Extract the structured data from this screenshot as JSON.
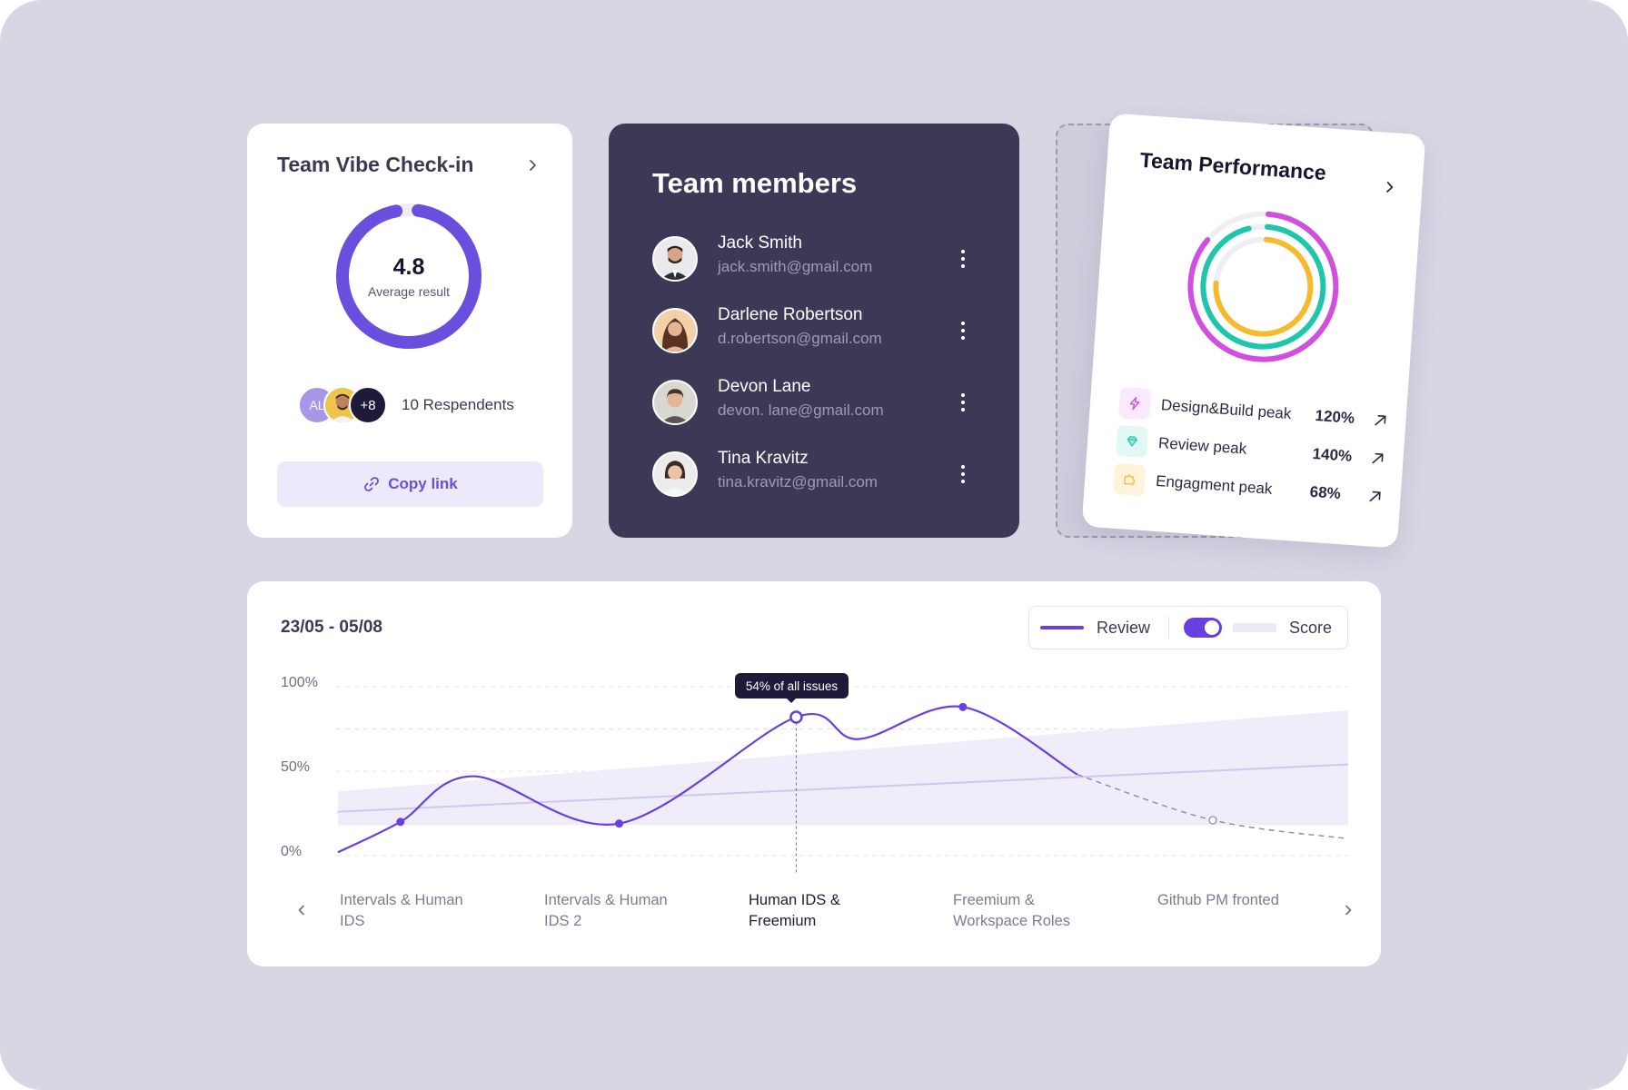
{
  "vibe": {
    "title": "Team Vibe Check-in",
    "average_value": "4.8",
    "average_label": "Average result",
    "score": 4.8,
    "score_max": 5,
    "avatar_initials": "AL",
    "avatar_more": "+8",
    "respondents": "10 Respendents",
    "copy_link": "Copy link",
    "accent": "#6a4fde"
  },
  "members": {
    "title": "Team members",
    "items": [
      {
        "name": "Jack Smith",
        "email": "jack.smith@gmail.com"
      },
      {
        "name": "Darlene Robertson",
        "email": "d.robertson@gmail.com"
      },
      {
        "name": "Devon Lane",
        "email": "devon. lane@gmail.com"
      },
      {
        "name": "Tina Kravitz",
        "email": "tina.kravitz@gmail.com"
      }
    ]
  },
  "performance": {
    "title": "Team Performance",
    "peaks": [
      {
        "label": "Design&Build peak",
        "value": "120%",
        "color": "#d04ee0",
        "icon": "lightning-icon"
      },
      {
        "label": "Review peak",
        "value": "140%",
        "color": "#1ec7ac",
        "icon": "diamond-icon"
      },
      {
        "label": "Engagment peak",
        "value": "68%",
        "color": "#f5bb2c",
        "icon": "puzzle-icon"
      }
    ]
  },
  "chart": {
    "date_range": "23/05 - 05/08",
    "legend_review": "Review",
    "legend_score": "Score",
    "tooltip": "54% of all issues"
  },
  "chart_data": {
    "type": "line",
    "categories": [
      "Intervals & Human IDS",
      "Intervals & Human IDS 2",
      "Human IDS & Freemium",
      "Freemium & Workspace Roles",
      "Github PM fronted"
    ],
    "y_ticks": [
      "100%",
      "50%",
      "0%"
    ],
    "ylim": [
      0,
      100
    ],
    "series": [
      {
        "name": "Review",
        "color": "#6a3fe0",
        "points": [
          [
            0,
            2
          ],
          [
            0.3,
            20
          ],
          [
            0.65,
            47
          ],
          [
            1.35,
            19
          ],
          [
            2.2,
            82
          ],
          [
            2.5,
            69
          ],
          [
            3.0,
            88
          ],
          [
            3.55,
            48
          ]
        ],
        "forecast": [
          [
            3.55,
            48
          ],
          [
            4.2,
            21
          ],
          [
            4.85,
            10
          ]
        ]
      },
      {
        "name": "Score",
        "color": "#cfc7f0",
        "points": [
          [
            0,
            26
          ],
          [
            4.85,
            54
          ]
        ],
        "band_low": [
          [
            0,
            18
          ],
          [
            4.85,
            18
          ]
        ],
        "band_high": [
          [
            0,
            38
          ],
          [
            4.85,
            86
          ]
        ]
      }
    ],
    "highlight": {
      "category": "Human IDS & Freemium",
      "x": 2.2,
      "y": 82
    }
  }
}
